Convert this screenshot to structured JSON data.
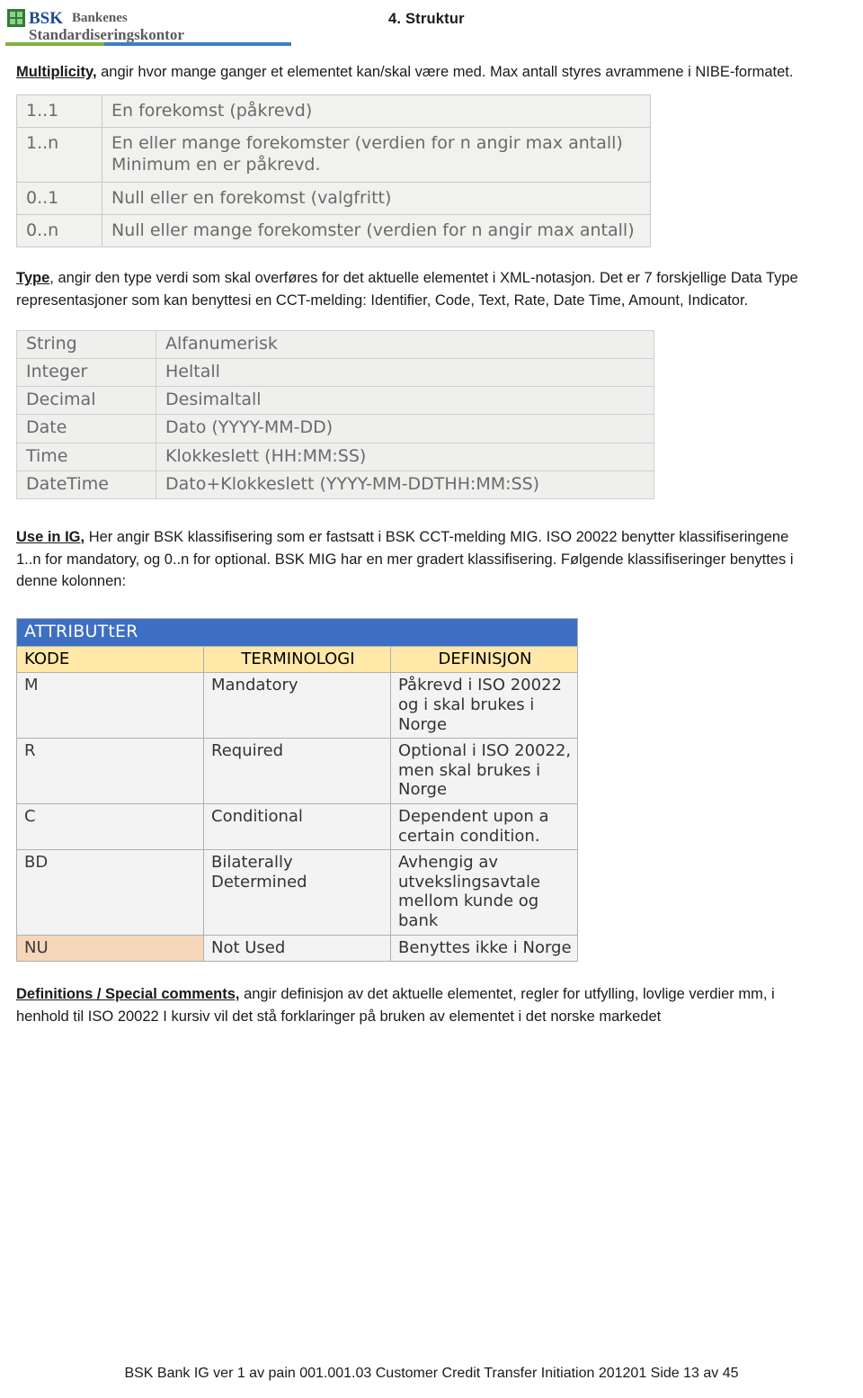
{
  "header": {
    "logo_line1": "Bankenes",
    "logo_line2": "Standardiseringskontor",
    "logo_abbrev": "BSK",
    "chapter": "4. Struktur"
  },
  "sections": {
    "multiplicity": {
      "lead_bold": "Multiplicity,",
      "lead_text": " angir hvor mange ganger et elementet kan/skal være med. Max antall styres avrammene i NIBE-formatet."
    },
    "type": {
      "lead_bold": "Type",
      "lead_text": ", angir den type verdi som skal overføres for det aktuelle elementet i XML-notasjon. Det er 7 forskjellige Data Type representasjoner som kan benyttesi en CCT-melding: Identifier, Code, Text, Rate, Date Time, Amount, Indicator."
    },
    "use_in_ig": {
      "lead_bold": "Use in IG,",
      "lead_text": " Her angir BSK klassifisering som er fastsatt i BSK CCT-melding  MIG. ISO 20022 benytter klassifiseringene 1..n for mandatory, og 0..n for optional. BSK MIG har en mer gradert klassifisering. Følgende klassifiseringer benyttes i denne kolonnen:"
    },
    "definitions": {
      "lead_bold": "Definitions / Special comments,",
      "lead_text": " angir definisjon av det aktuelle elementet, regler for utfylling, lovlige verdier mm, i henhold til ISO 20022 I kursiv vil det stå  forklaringer på bruken av elementet i det norske markedet"
    }
  },
  "multiplicity_table": {
    "rows": [
      {
        "code": "1..1",
        "desc": "En forekomst (påkrevd)"
      },
      {
        "code": "1..n",
        "desc": "En eller mange forekomster (verdien for n angir max antall)\nMinimum en er påkrevd."
      },
      {
        "code": "0..1",
        "desc": "Null eller en forekomst (valgfritt)"
      },
      {
        "code": "0..n",
        "desc": "Null eller mange forekomster (verdien for n angir max antall)"
      }
    ]
  },
  "types_table": {
    "rows": [
      {
        "type": "String",
        "desc": "Alfanumerisk"
      },
      {
        "type": "Integer",
        "desc": "Heltall"
      },
      {
        "type": "Decimal",
        "desc": "Desimaltall"
      },
      {
        "type": "Date",
        "desc": "Dato (YYYY-MM-DD)"
      },
      {
        "type": "Time",
        "desc": "Klokkeslett (HH:MM:SS)"
      },
      {
        "type": "DateTime",
        "desc": "Dato+Klokkeslett (YYYY-MM-DDTHH:MM:SS)"
      }
    ]
  },
  "attributes_table": {
    "title": "ATTRIBUTtER",
    "headers": [
      "KODE",
      "TERMINOLOGI",
      "DEFINISJON"
    ],
    "rows": [
      {
        "kode": "M",
        "terminologi": "Mandatory",
        "definisjon": "Påkrevd i ISO 20022 og i skal brukes i Norge"
      },
      {
        "kode": "R",
        "terminologi": "Required",
        "definisjon": "Optional i ISO 20022, men skal brukes i Norge"
      },
      {
        "kode": "C",
        "terminologi": "Conditional",
        "definisjon": "Dependent upon a certain condition."
      },
      {
        "kode": "BD",
        "terminologi": "Bilaterally Determined",
        "definisjon": "Avhengig av utvekslingsavtale mellom kunde og bank"
      },
      {
        "kode": "NU",
        "terminologi": "Not Used",
        "definisjon": "Benyttes ikke i Norge"
      }
    ]
  },
  "footer": {
    "text": "BSK Bank IG ver 1 av pain 001.001.03 Customer Credit Transfer Initiation 201201  Side 13 av 45"
  }
}
